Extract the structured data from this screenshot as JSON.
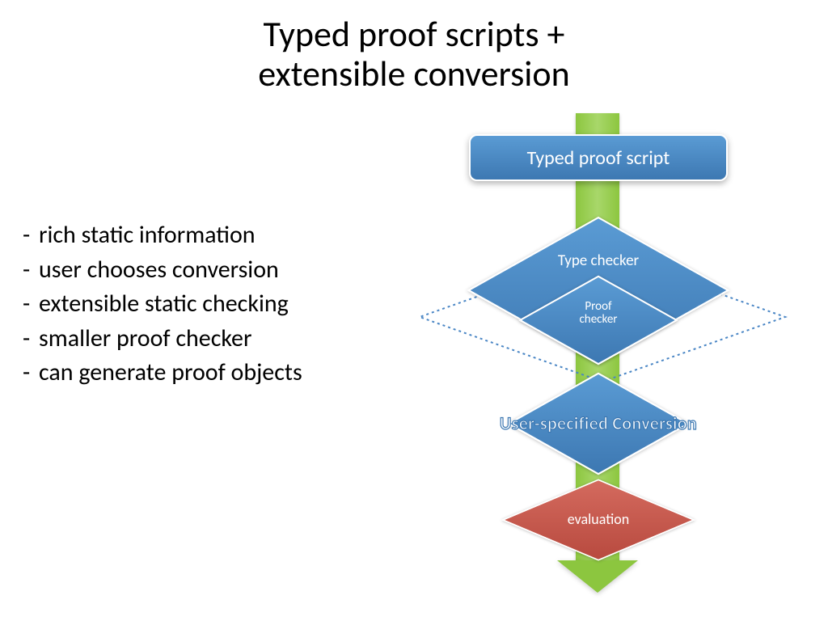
{
  "title_line1": "Typed proof scripts +",
  "title_line2": "extensible conversion",
  "bullets": [
    "rich static information",
    "user chooses conversion",
    "extensible static checking",
    "smaller proof checker",
    "can generate proof objects"
  ],
  "flow": {
    "top_box": "Typed proof script",
    "type_checker": "Type checker",
    "proof_checker": "Proof\nchecker",
    "conversion": "User-specified Conversion",
    "evaluation": "evaluation"
  },
  "colors": {
    "blue": "#4a86c5",
    "red": "#c25b52",
    "green": "#8cc63f"
  }
}
